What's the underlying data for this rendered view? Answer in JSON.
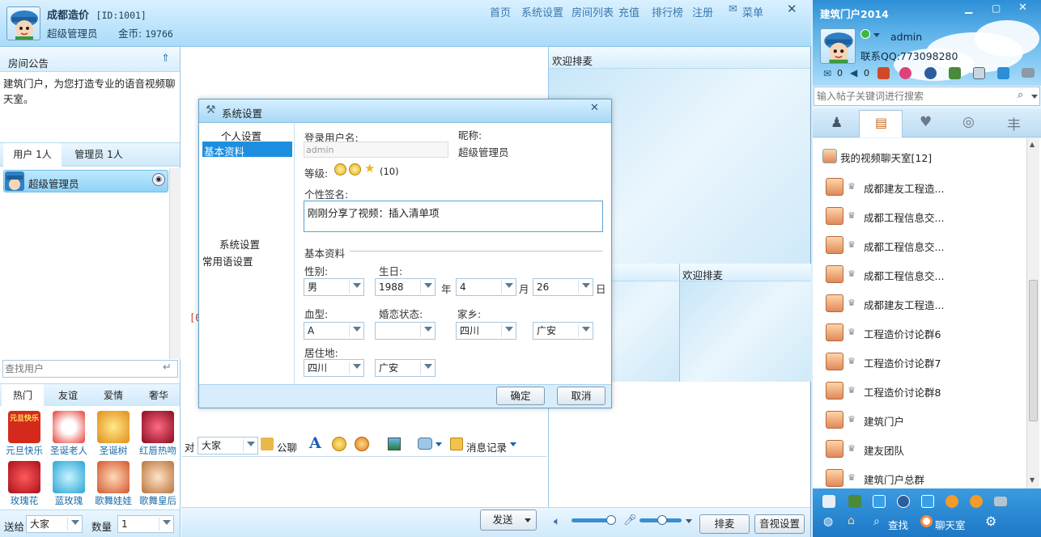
{
  "header": {
    "room_name": "成都造价",
    "room_id": "[ID:1001]",
    "user_role": "超级管理员",
    "coins_label": "金币:",
    "coins_value": "19766",
    "nav": [
      "首页",
      "系统设置",
      "房间列表",
      "充值",
      "排行榜",
      "注册"
    ],
    "menu_label": "菜单"
  },
  "left": {
    "notice_title": "房间公告",
    "notice_text": "建筑门户，为您打造专业的语音视频聊天室。",
    "tab_users": "用户 1人",
    "tab_admins": "管理员 1人",
    "user_entry": "超级管理员",
    "search_placeholder": "查找用户",
    "gift_tabs": [
      "热门",
      "友谊",
      "爱情",
      "奢华"
    ],
    "gifts": [
      "元旦快乐",
      "圣诞老人",
      "圣诞树",
      "红唇热吻",
      "玫瑰花",
      "蓝玫瑰",
      "歌舞娃娃",
      "歌舞皇后"
    ],
    "gift_img_text": "元旦快乐",
    "send_to_label": "送给",
    "send_to_value": "大家",
    "qty_label": "数量",
    "qty_value": "1"
  },
  "center": {
    "welcome_1": "欢迎排麦",
    "welcome_2": "欢迎排麦",
    "chat_fragment": "[0",
    "to_label": "对",
    "to_value": "大家",
    "public_chat": "公聊",
    "msg_record": "消息记录",
    "send_button": "发送",
    "queue_button": "排麦",
    "av_settings_button": "音视设置"
  },
  "dialog": {
    "title": "系统设置",
    "nav_group1": "个人设置",
    "nav_item_basic": "基本资料",
    "nav_group2": "系统设置",
    "nav_item_phrases": "常用语设置",
    "login_name_label": "登录用户名:",
    "login_name_value": "admin",
    "nickname_label": "昵称:",
    "nickname_value": "超级管理员",
    "level_label": "等级:",
    "level_value": "(10)",
    "signature_label": "个性签名:",
    "signature_value": "刚刚分享了视频：插入清单项",
    "basic_section": "基本资料",
    "gender_label": "性别:",
    "gender_value": "男",
    "birthday_label": "生日:",
    "year_value": "1988",
    "year_unit": "年",
    "month_value": "4",
    "month_unit": "月",
    "day_value": "26",
    "day_unit": "日",
    "blood_label": "血型:",
    "blood_value": "A",
    "marital_label": "婚恋状态:",
    "marital_value": "",
    "hometown_label": "家乡:",
    "hometown_province": "四川",
    "hometown_city": "广安",
    "residence_label": "居住地:",
    "residence_province": "四川",
    "residence_city": "广安",
    "ok_button": "确定",
    "cancel_button": "取消"
  },
  "right": {
    "app_title": "建筑门户2014",
    "username": "admin",
    "qq_contact": "联系QQ:773098280",
    "mail_count": "0",
    "voice_count": "0",
    "search_placeholder": "输入帖子关键词进行搜索",
    "list_header": "我的视频聊天室[12]",
    "rooms": [
      "成都建友工程造...",
      "成都工程信息交...",
      "成都工程信息交...",
      "成都工程信息交...",
      "成都建友工程造...",
      "工程造价讨论群6",
      "工程造价讨论群7",
      "工程造价讨论群8",
      "建筑门户",
      "建友团队",
      "建筑门户总群"
    ],
    "bottom_search": "查找",
    "bottom_chatroom": "聊天室"
  }
}
